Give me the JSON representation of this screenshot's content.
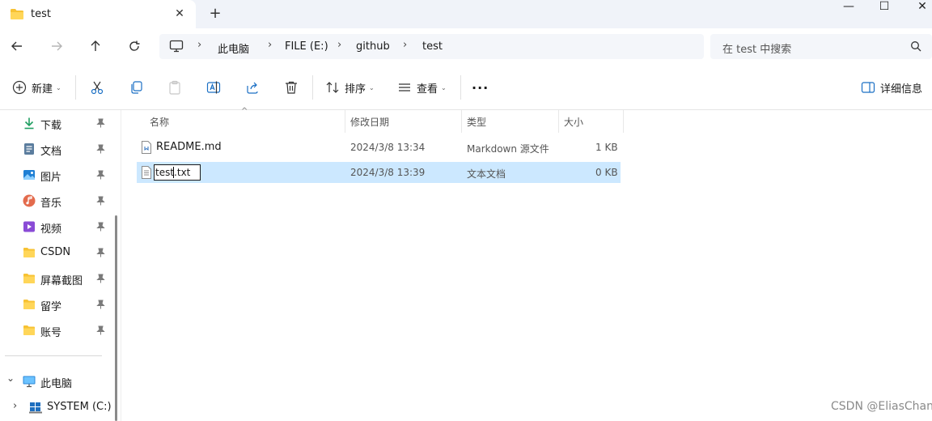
{
  "window": {
    "tab_title": "test",
    "tab_close": "✕",
    "new_tab": "+",
    "minimize": "—",
    "maximize": "☐",
    "close": "✕"
  },
  "address": {
    "crumbs": [
      "此电脑",
      "FILE (E:)",
      "github",
      "test"
    ],
    "separator": "›",
    "search_placeholder": "在 test 中搜索"
  },
  "toolbar": {
    "new_label": "新建",
    "sort_label": "排序",
    "view_label": "查看",
    "more_label": "···",
    "details_label": "详细信息",
    "caret": "⌄"
  },
  "sidebar": {
    "quick_access": [
      {
        "label": "下载",
        "icon": "download-icon"
      },
      {
        "label": "文档",
        "icon": "document-icon"
      },
      {
        "label": "图片",
        "icon": "picture-icon"
      },
      {
        "label": "音乐",
        "icon": "music-icon"
      },
      {
        "label": "视频",
        "icon": "video-icon"
      },
      {
        "label": "CSDN",
        "icon": "folder-icon"
      },
      {
        "label": "屏幕截图",
        "icon": "folder-icon"
      },
      {
        "label": "留学",
        "icon": "folder-icon"
      },
      {
        "label": "账号",
        "icon": "folder-icon"
      }
    ],
    "this_pc": "此电脑",
    "system_drive": "SYSTEM (C:)",
    "expand_open": "⌄",
    "expand_closed": "›"
  },
  "columns": {
    "name": "名称",
    "modified": "修改日期",
    "type": "类型",
    "size": "大小",
    "sort_indicator": "^"
  },
  "files": [
    {
      "name": "README.md",
      "modified": "2024/3/8 13:34",
      "type": "Markdown 源文件",
      "size": "1 KB",
      "selected": false
    },
    {
      "name": "test.txt",
      "modified": "2024/3/8 13:39",
      "type": "文本文档",
      "size": "0 KB",
      "selected": true
    }
  ],
  "watermark": "CSDN @EliasChang",
  "colors": {
    "accent": "#0067c0",
    "selection": "#cce8ff",
    "folder": "#f7c233"
  }
}
